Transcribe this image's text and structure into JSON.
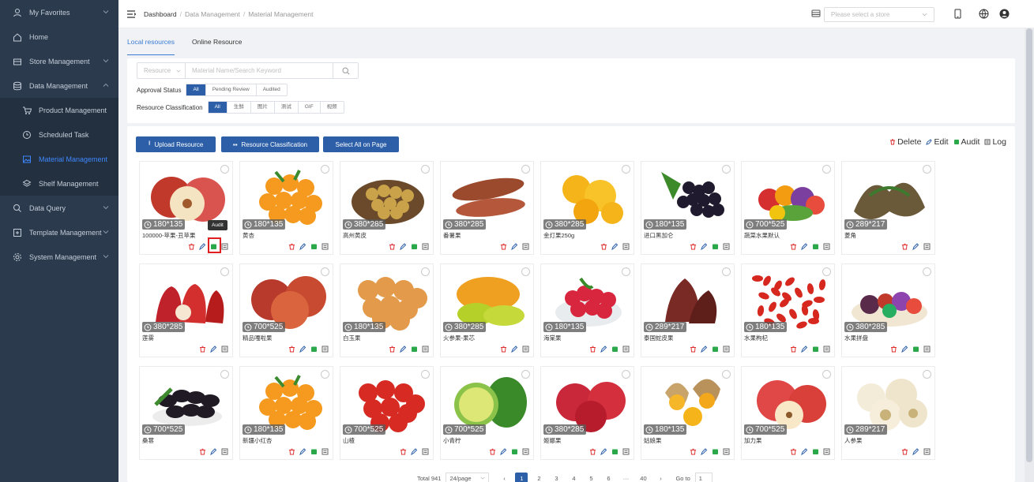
{
  "sidebar": {
    "items": [
      {
        "label": "My Favorites",
        "icon": "user-icon",
        "has_chevron": true
      },
      {
        "label": "Home",
        "icon": "home-icon",
        "has_chevron": false
      },
      {
        "label": "Store Management",
        "icon": "store-icon",
        "has_chevron": true
      },
      {
        "label": "Data Management",
        "icon": "database-icon",
        "has_chevron": true,
        "open": true
      },
      {
        "label": "Product Management",
        "icon": "cart-icon",
        "sub": true
      },
      {
        "label": "Scheduled Task",
        "icon": "clock-icon",
        "sub": true
      },
      {
        "label": "Material Management",
        "icon": "image-icon",
        "sub": true,
        "active": true
      },
      {
        "label": "Shelf Management",
        "icon": "layers-icon",
        "sub": true
      },
      {
        "label": "Data Query",
        "icon": "search-icon",
        "has_chevron": true
      },
      {
        "label": "Template Management",
        "icon": "template-icon",
        "has_chevron": true
      },
      {
        "label": "System Management",
        "icon": "gear-icon",
        "has_chevron": true
      }
    ]
  },
  "header": {
    "breadcrumb": [
      "Dashboard",
      "Data Management",
      "Material Management"
    ],
    "store_placeholder": "Please select a store"
  },
  "tabs": [
    {
      "label": "Local resources",
      "active": true
    },
    {
      "label": "Online Resource",
      "active": false
    }
  ],
  "filters": {
    "search_type": "Resource",
    "search_placeholder": "Material Name/Search Keyword",
    "approval_label": "Approval Status",
    "approval_options": [
      "All",
      "Pending Review",
      "Audited"
    ],
    "approval_selected": 0,
    "classification_label": "Resource Classification",
    "classification_options": [
      "All",
      "生鲜",
      "图片",
      "测试",
      "GIF",
      "视频"
    ],
    "classification_selected": 0
  },
  "actions": {
    "upload": "Upload Resource",
    "classification": "Resource Classification",
    "select_all": "Select All on Page"
  },
  "legend": {
    "delete": "Delete",
    "edit": "Edit",
    "audit": "Audit",
    "log": "Log"
  },
  "tooltip": "Audit",
  "cards": [
    {
      "name": "100000-苹果-丑苹果",
      "size": "180*135",
      "audit": true,
      "fruit": "apple-cut"
    },
    {
      "name": "黄杏",
      "size": "180*135",
      "audit": true,
      "fruit": "apricot"
    },
    {
      "name": "高州黄皮",
      "size": "380*285",
      "audit": true,
      "fruit": "wampee"
    },
    {
      "name": "番薯果",
      "size": "380*285",
      "audit": false,
      "fruit": "sweetpotato"
    },
    {
      "name": "金灯果250g",
      "size": "380*285",
      "audit": false,
      "fruit": "physalis"
    },
    {
      "name": "进口黑加仑",
      "size": "180*135",
      "audit": true,
      "fruit": "blackcurrant"
    },
    {
      "name": "蔬菜水果默认",
      "size": "700*525",
      "audit": true,
      "fruit": "mixed"
    },
    {
      "name": "菱角",
      "size": "289*217",
      "audit": false,
      "fruit": "waterchestnut"
    },
    {
      "name": "莲雾",
      "size": "380*285",
      "audit": false,
      "fruit": "waxapple"
    },
    {
      "name": "精品嘎啦果",
      "size": "700*525",
      "audit": true,
      "fruit": "gala"
    },
    {
      "name": "白玉果",
      "size": "180*135",
      "audit": true,
      "fruit": "loquat"
    },
    {
      "name": "火参果-果芯",
      "size": "380*285",
      "audit": false,
      "fruit": "kiwano"
    },
    {
      "name": "海棠果",
      "size": "180*135",
      "audit": true,
      "fruit": "crabapple"
    },
    {
      "name": "泰国蛇皮果",
      "size": "289*217",
      "audit": true,
      "fruit": "salak"
    },
    {
      "name": "水果枸杞",
      "size": "180*135",
      "audit": true,
      "fruit": "goji"
    },
    {
      "name": "水果拼盘",
      "size": "380*285",
      "audit": true,
      "fruit": "platter"
    },
    {
      "name": "桑葚",
      "size": "700*525",
      "audit": false,
      "fruit": "mulberry"
    },
    {
      "name": "新疆小红杏",
      "size": "180*135",
      "audit": true,
      "fruit": "apricot"
    },
    {
      "name": "山楂",
      "size": "700*525",
      "audit": false,
      "fruit": "hawthorn"
    },
    {
      "name": "小青柠",
      "size": "700*525",
      "audit": true,
      "fruit": "lime"
    },
    {
      "name": "姬娜果",
      "size": "380*285",
      "audit": true,
      "fruit": "ginaapple"
    },
    {
      "name": "姑娘果",
      "size": "180*135",
      "audit": true,
      "fruit": "physalis2"
    },
    {
      "name": "加力果",
      "size": "700*525",
      "audit": true,
      "fruit": "galaapple"
    },
    {
      "name": "人参果",
      "size": "289*217",
      "audit": false,
      "fruit": "pepino"
    }
  ],
  "pagination": {
    "total": "Total 941",
    "page_size": "24/page",
    "pages": [
      "1",
      "2",
      "3",
      "4",
      "5",
      "6",
      "···",
      "40"
    ],
    "current": "1",
    "goto_label": "Go to",
    "goto_value": "1"
  }
}
